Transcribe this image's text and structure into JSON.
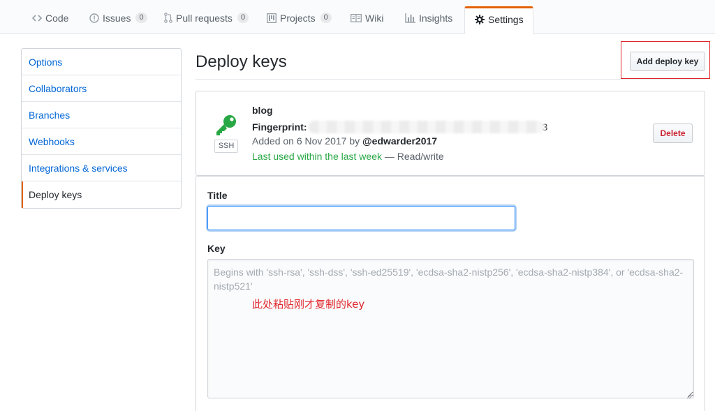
{
  "tabs": [
    {
      "label": "Code",
      "icon": "code-icon"
    },
    {
      "label": "Issues",
      "icon": "issue-opened-icon",
      "count": "0"
    },
    {
      "label": "Pull requests",
      "icon": "git-pull-request-icon",
      "count": "0"
    },
    {
      "label": "Projects",
      "icon": "project-icon",
      "count": "0"
    },
    {
      "label": "Wiki",
      "icon": "book-icon"
    },
    {
      "label": "Insights",
      "icon": "graph-icon"
    },
    {
      "label": "Settings",
      "icon": "gear-icon",
      "selected": true
    }
  ],
  "menu": {
    "items": [
      "Options",
      "Collaborators",
      "Branches",
      "Webhooks",
      "Integrations & services",
      "Deploy keys"
    ],
    "selected": "Deploy keys"
  },
  "page": {
    "title": "Deploy keys",
    "add_button": "Add deploy key"
  },
  "key": {
    "title": "blog",
    "fingerprint_label": "Fingerprint:",
    "fingerprint_tail": "3",
    "added_prefix": "Added on 6 Nov 2017 by ",
    "added_user": "@edwarder2017",
    "last_used": "Last used within the last week",
    "access": " — Read/write",
    "type": "SSH",
    "delete_button": "Delete"
  },
  "form": {
    "title_label": "Title",
    "title_value": "",
    "key_label": "Key",
    "key_placeholder": "Begins with 'ssh-rsa', 'ssh-dss', 'ssh-ed25519', 'ecdsa-sha2-nistp256', 'ecdsa-sha2-nistp384', or 'ecdsa-sha2-nistp521'",
    "annotation": "此处粘贴刚才复制的key"
  },
  "colors": {
    "accent": "#e36209",
    "link": "#0366d6",
    "success": "#28a745",
    "danger": "#cb2431",
    "annotation_red": "#e0262b"
  }
}
